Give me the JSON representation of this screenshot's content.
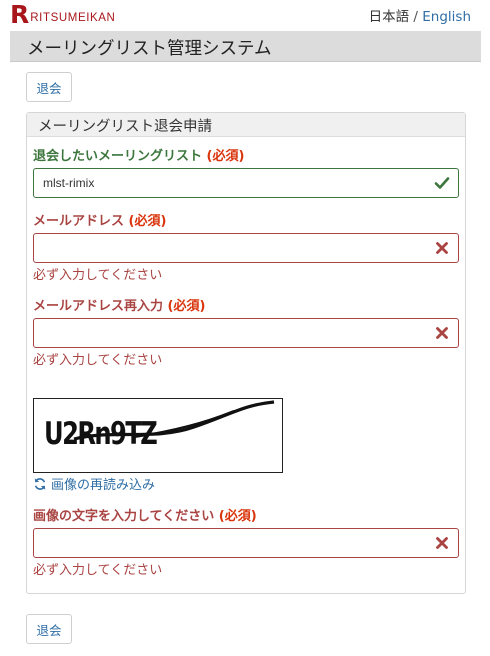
{
  "logo": {
    "letter": "R",
    "text": "RITSUMEIKAN"
  },
  "lang": {
    "japanese": "日本語",
    "separator": "/",
    "english": "English"
  },
  "header": {
    "title": "メーリングリスト管理システム"
  },
  "buttons": {
    "unsubscribe_top": "退会",
    "unsubscribe_bottom": "退会"
  },
  "panel": {
    "title": "メーリングリスト退会申請"
  },
  "fields": {
    "mailing_list": {
      "label": "退会したいメーリングリスト",
      "required": "(必須)",
      "value": "mlst-rimix"
    },
    "email": {
      "label": "メールアドレス",
      "required": "(必須)",
      "value": "",
      "help": "必ず入力してください"
    },
    "email_confirm": {
      "label": "メールアドレス再入力",
      "required": "(必須)",
      "value": "",
      "help": "必ず入力してください"
    },
    "captcha_input": {
      "label": "画像の文字を入力してください",
      "required": "(必須)",
      "value": "",
      "help": "必ず入力してください"
    }
  },
  "captcha": {
    "text": "U2Rn9TZ",
    "reload": "画像の再読み込み"
  },
  "colors": {
    "brand": "#a8161b",
    "link": "#2f6ea6",
    "success": "#3c763d",
    "error": "#a94442",
    "required": "#d9340c"
  },
  "icons": {
    "valid": "check-icon",
    "invalid": "x-icon",
    "reload": "refresh-icon"
  }
}
